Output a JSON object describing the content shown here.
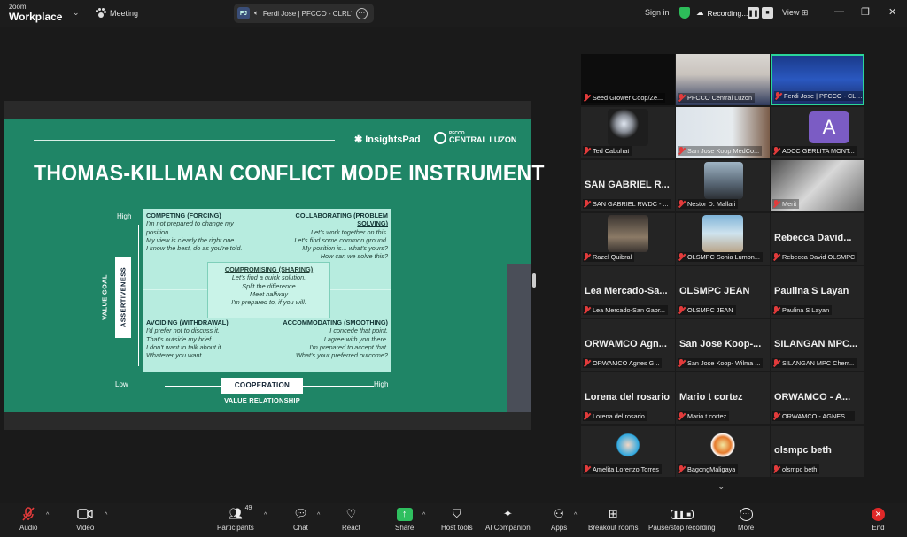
{
  "topbar": {
    "brand_small": "zoom",
    "brand_large": "Workplace",
    "meeting_label": "Meeting",
    "speaker_initials": "FJ",
    "speaker_name": "Ferdi Jose | PFCCO - CLRL's s",
    "signin": "Sign in",
    "recording": "Recording...",
    "view": "View"
  },
  "slide": {
    "logo_insightspad": "InsightsPad",
    "logo_pfcco_small": "PFCCO",
    "logo_pfcco_large": "CENTRAL LUZON",
    "title": "THOMAS-KILLMAN CONFLICT MODE INSTRUMENT",
    "high_left": "High",
    "low": "Low",
    "high_right": "High",
    "assertiveness": "ASSERTIVENESS",
    "value_goal": "VALUE GOAL",
    "cooperation": "COOPERATION",
    "value_relationship": "VALUE RELATIONSHIP",
    "competing": {
      "heading": "COMPETING (FORCING)",
      "lines": [
        "I'm not prepared to change my",
        "position.",
        "My view is clearly the right one.",
        "I know the best, do as you're told."
      ]
    },
    "collaborating": {
      "heading": "COLLABORATING (PROBLEM SOLVING)",
      "lines": [
        "Let's work together on this.",
        "Let's find some common ground.",
        "My position is... what's yours?",
        "How can we solve this?"
      ]
    },
    "compromising": {
      "heading": "COMPROMISING (SHARING)",
      "lines": [
        "Let's find a quick solution.",
        "Split the difference",
        "Meet halfway",
        "I'm prepared to, if you will."
      ]
    },
    "avoiding": {
      "heading": "AVOIDING (WITHDRAWAL)",
      "lines": [
        "I'd prefer not to discuss it.",
        "That's outside my brief.",
        "I don't want to talk about it.",
        "Whatever you want."
      ]
    },
    "accommodating": {
      "heading": "ACCOMMODATING (SMOOTHING)",
      "lines": [
        "I concede that point.",
        "I agree with you there.",
        "I'm prepared to accept that.",
        "What's your preferred outcome?"
      ]
    }
  },
  "gallery": [
    {
      "name": "Seed Grower Coop/Ze...",
      "big": ""
    },
    {
      "name": "PFCCO Central Luzon",
      "big": ""
    },
    {
      "name": "Ferdi Jose | PFCCO - CLRL",
      "big": ""
    },
    {
      "name": "Ted Cabuhat",
      "big": ""
    },
    {
      "name": "San Jose Koop MedCo...",
      "big": ""
    },
    {
      "name": "ADCC GERLITA MONT...",
      "big": "",
      "avatar": "A"
    },
    {
      "name": "SAN GABRIEL RWDC - ...",
      "big": "SAN GABRIEL R..."
    },
    {
      "name": "Nestor D. Mallari",
      "big": ""
    },
    {
      "name": "Merit",
      "big": ""
    },
    {
      "name": "Razel Quibral",
      "big": ""
    },
    {
      "name": "OLSMPC Sonia Lumon...",
      "big": ""
    },
    {
      "name": "Rebecca David OLSMPC",
      "big": "Rebecca David..."
    },
    {
      "name": "Lea Mercado-San Gabr...",
      "big": "Lea Mercado-Sa..."
    },
    {
      "name": "OLSMPC JEAN",
      "big": "OLSMPC JEAN"
    },
    {
      "name": "Paulina S Layan",
      "big": "Paulina S Layan"
    },
    {
      "name": "ORWAMCO Agnes G...",
      "big": "ORWAMCO Agn..."
    },
    {
      "name": "San Jose Koop- Wilma ...",
      "big": "San Jose Koop-..."
    },
    {
      "name": "SILANGAN MPC Cherr...",
      "big": "SILANGAN MPC..."
    },
    {
      "name": "Lorena del rosario",
      "big": "Lorena del rosario"
    },
    {
      "name": "Mario t cortez",
      "big": "Mario t cortez"
    },
    {
      "name": "ORWAMCO - AGNES ...",
      "big": "ORWAMCO - A..."
    },
    {
      "name": "Amelita Lorenzo Torres",
      "big": ""
    },
    {
      "name": "BagongMaligaya",
      "big": ""
    },
    {
      "name": "olsmpc beth",
      "big": "olsmpc beth"
    }
  ],
  "toolbar": {
    "audio": "Audio",
    "video": "Video",
    "participants": "Participants",
    "participants_count": "49",
    "chat": "Chat",
    "react": "React",
    "share": "Share",
    "host_tools": "Host tools",
    "ai_companion": "AI Companion",
    "apps": "Apps",
    "breakout": "Breakout rooms",
    "pause_stop": "Pause/stop recording",
    "more": "More",
    "end": "End"
  },
  "colors": {
    "slide_bg": "#1f8566",
    "quadrant_bg": "#b7ecdf",
    "active_border": "#2ad69a",
    "share_green": "#2fbf5f",
    "end_red": "#e02828"
  }
}
